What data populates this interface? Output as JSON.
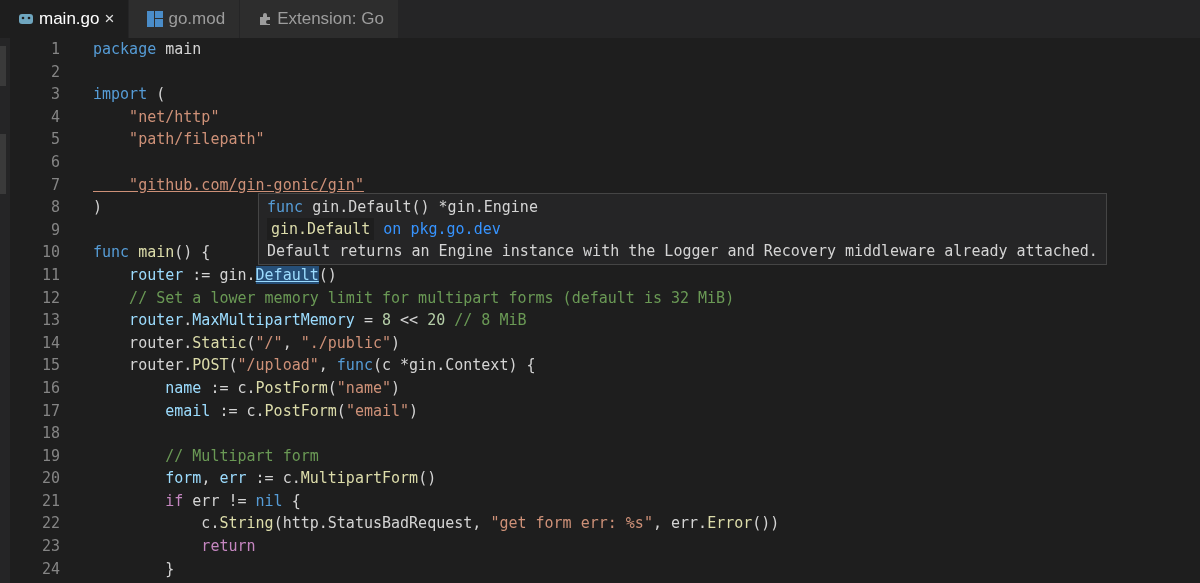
{
  "tabs": [
    {
      "label": "main.go",
      "selected": true,
      "close": "×"
    },
    {
      "label": "go.mod",
      "selected": false
    },
    {
      "label": "Extension: Go",
      "selected": false
    }
  ],
  "lines": [
    {
      "number": "1",
      "tokens": [
        {
          "kind": "kw",
          "text": "package"
        },
        {
          "kind": "pl",
          "text": " main"
        }
      ]
    },
    {
      "number": "2"
    },
    {
      "number": "3",
      "tokens": [
        {
          "kind": "kw",
          "text": "import"
        },
        {
          "kind": "pl",
          "text": " ("
        }
      ]
    },
    {
      "number": "4",
      "tokens": [
        {
          "kind": "str",
          "text": "    \"net/http\""
        }
      ]
    },
    {
      "number": "5",
      "tokens": [
        {
          "kind": "str",
          "text": "    \"path/filepath\""
        }
      ]
    },
    {
      "number": "6"
    },
    {
      "number": "7",
      "tokens": [
        {
          "kind": "link",
          "text": "    \"github.com/gin-gonic/gin\""
        }
      ]
    },
    {
      "number": "8",
      "tokens": [
        {
          "kind": "pl",
          "text": ")"
        }
      ]
    },
    {
      "number": "9"
    },
    {
      "number": "10",
      "tokens": [
        {
          "kind": "kw",
          "text": "func"
        },
        {
          "kind": "fn",
          "text": " main"
        },
        {
          "kind": "pl",
          "text": "() {"
        }
      ]
    },
    {
      "number": "11",
      "tokens": [
        {
          "kind": "var",
          "text": "    router"
        },
        {
          "kind": "pl",
          "text": " := gin."
        },
        {
          "kind": "hl",
          "text": "Default"
        },
        {
          "kind": "pl",
          "text": "()"
        }
      ]
    },
    {
      "number": "12",
      "tokens": [
        {
          "kind": "cmt",
          "text": "    // Set a lower memory limit for multipart forms (default is 32 MiB)"
        }
      ]
    },
    {
      "number": "13",
      "tokens": [
        {
          "kind": "var",
          "text": "    router"
        },
        {
          "kind": "pl",
          "text": "."
        },
        {
          "kind": "var",
          "text": "MaxMultipartMemory"
        },
        {
          "kind": "pl",
          "text": " = "
        },
        {
          "kind": "num",
          "text": "8"
        },
        {
          "kind": "pl",
          "text": " << "
        },
        {
          "kind": "num",
          "text": "20"
        },
        {
          "kind": "cmt",
          "text": " // 8 MiB"
        }
      ]
    },
    {
      "number": "14",
      "tokens": [
        {
          "kind": "pl",
          "text": "    router."
        },
        {
          "kind": "fn",
          "text": "Static"
        },
        {
          "kind": "pl",
          "text": "("
        },
        {
          "kind": "str",
          "text": "\"/\""
        },
        {
          "kind": "pl",
          "text": ", "
        },
        {
          "kind": "str",
          "text": "\"./public\""
        },
        {
          "kind": "pl",
          "text": ")"
        }
      ]
    },
    {
      "number": "15",
      "tokens": [
        {
          "kind": "pl",
          "text": "    router."
        },
        {
          "kind": "fn",
          "text": "POST"
        },
        {
          "kind": "pl",
          "text": "("
        },
        {
          "kind": "str",
          "text": "\"/upload\""
        },
        {
          "kind": "pl",
          "text": ", "
        },
        {
          "kind": "kw",
          "text": "func"
        },
        {
          "kind": "pl",
          "text": "(c *gin.Context) {"
        }
      ]
    },
    {
      "number": "16",
      "tokens": [
        {
          "kind": "var",
          "text": "        name"
        },
        {
          "kind": "pl",
          "text": " := c."
        },
        {
          "kind": "fn",
          "text": "PostForm"
        },
        {
          "kind": "pl",
          "text": "("
        },
        {
          "kind": "str",
          "text": "\"name\""
        },
        {
          "kind": "pl",
          "text": ")"
        }
      ]
    },
    {
      "number": "17",
      "tokens": [
        {
          "kind": "var",
          "text": "        email"
        },
        {
          "kind": "pl",
          "text": " := c."
        },
        {
          "kind": "fn",
          "text": "PostForm"
        },
        {
          "kind": "pl",
          "text": "("
        },
        {
          "kind": "str",
          "text": "\"email\""
        },
        {
          "kind": "pl",
          "text": ")"
        }
      ]
    },
    {
      "number": "18"
    },
    {
      "number": "19",
      "tokens": [
        {
          "kind": "cmt",
          "text": "        // Multipart form"
        }
      ]
    },
    {
      "number": "20",
      "tokens": [
        {
          "kind": "var",
          "text": "        form"
        },
        {
          "kind": "pl",
          "text": ", "
        },
        {
          "kind": "var",
          "text": "err"
        },
        {
          "kind": "pl",
          "text": " := c."
        },
        {
          "kind": "fn",
          "text": "MultipartForm"
        },
        {
          "kind": "pl",
          "text": "()"
        }
      ]
    },
    {
      "number": "21",
      "tokens": [
        {
          "kind": "ctl",
          "text": "        if"
        },
        {
          "kind": "pl",
          "text": " err != "
        },
        {
          "kind": "kw",
          "text": "nil"
        },
        {
          "kind": "pl",
          "text": " {"
        }
      ]
    },
    {
      "number": "22",
      "tokens": [
        {
          "kind": "pl",
          "text": "            c."
        },
        {
          "kind": "fn",
          "text": "String"
        },
        {
          "kind": "pl",
          "text": "(http.StatusBadRequest, "
        },
        {
          "kind": "str",
          "text": "\"get form err: %s\""
        },
        {
          "kind": "pl",
          "text": ", err."
        },
        {
          "kind": "fn",
          "text": "Error"
        },
        {
          "kind": "pl",
          "text": "())"
        }
      ]
    },
    {
      "number": "23",
      "tokens": [
        {
          "kind": "ctl",
          "text": "            return"
        }
      ]
    },
    {
      "number": "24",
      "tokens": [
        {
          "kind": "pl",
          "text": "        }"
        }
      ]
    }
  ],
  "hover": {
    "signature": [
      {
        "kind": "kw",
        "text": "func"
      },
      {
        "kind": "pl",
        "text": " gin.Default() *gin.Engine"
      }
    ],
    "symbol": "gin.Default",
    "link": "on pkg.go.dev",
    "description": "Default returns an Engine instance with the Logger and Recovery middleware already attached."
  }
}
